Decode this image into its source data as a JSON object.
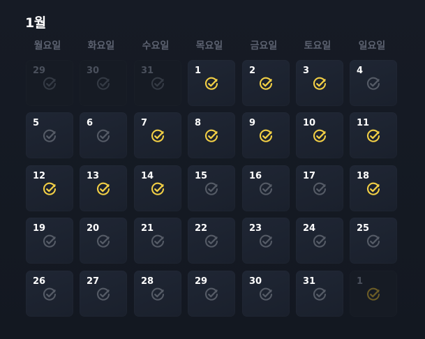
{
  "calendar": {
    "month_label": "1월",
    "weekdays": [
      "월요일",
      "화요일",
      "수요일",
      "목요일",
      "금요일",
      "토요일",
      "일요일"
    ],
    "colors": {
      "checked": "#f2cf45",
      "unchecked": "#555b66",
      "outside_checked": "#6b5c26",
      "outside_unchecked": "#343a44"
    },
    "weeks": [
      [
        {
          "day": "29",
          "outside": true,
          "checked": false
        },
        {
          "day": "30",
          "outside": true,
          "checked": false
        },
        {
          "day": "31",
          "outside": true,
          "checked": false
        },
        {
          "day": "1",
          "outside": false,
          "checked": true
        },
        {
          "day": "2",
          "outside": false,
          "checked": true
        },
        {
          "day": "3",
          "outside": false,
          "checked": true
        },
        {
          "day": "4",
          "outside": false,
          "checked": false
        }
      ],
      [
        {
          "day": "5",
          "outside": false,
          "checked": false
        },
        {
          "day": "6",
          "outside": false,
          "checked": false
        },
        {
          "day": "7",
          "outside": false,
          "checked": true
        },
        {
          "day": "8",
          "outside": false,
          "checked": true
        },
        {
          "day": "9",
          "outside": false,
          "checked": true
        },
        {
          "day": "10",
          "outside": false,
          "checked": true
        },
        {
          "day": "11",
          "outside": false,
          "checked": true
        }
      ],
      [
        {
          "day": "12",
          "outside": false,
          "checked": true
        },
        {
          "day": "13",
          "outside": false,
          "checked": true
        },
        {
          "day": "14",
          "outside": false,
          "checked": true
        },
        {
          "day": "15",
          "outside": false,
          "checked": false
        },
        {
          "day": "16",
          "outside": false,
          "checked": false
        },
        {
          "day": "17",
          "outside": false,
          "checked": false
        },
        {
          "day": "18",
          "outside": false,
          "checked": true
        }
      ],
      [
        {
          "day": "19",
          "outside": false,
          "checked": false
        },
        {
          "day": "20",
          "outside": false,
          "checked": false
        },
        {
          "day": "21",
          "outside": false,
          "checked": false
        },
        {
          "day": "22",
          "outside": false,
          "checked": false
        },
        {
          "day": "23",
          "outside": false,
          "checked": false
        },
        {
          "day": "24",
          "outside": false,
          "checked": false
        },
        {
          "day": "25",
          "outside": false,
          "checked": false
        }
      ],
      [
        {
          "day": "26",
          "outside": false,
          "checked": false
        },
        {
          "day": "27",
          "outside": false,
          "checked": false
        },
        {
          "day": "28",
          "outside": false,
          "checked": false
        },
        {
          "day": "29",
          "outside": false,
          "checked": false
        },
        {
          "day": "30",
          "outside": false,
          "checked": false
        },
        {
          "day": "31",
          "outside": false,
          "checked": false
        },
        {
          "day": "1",
          "outside": true,
          "checked": true
        }
      ]
    ]
  }
}
